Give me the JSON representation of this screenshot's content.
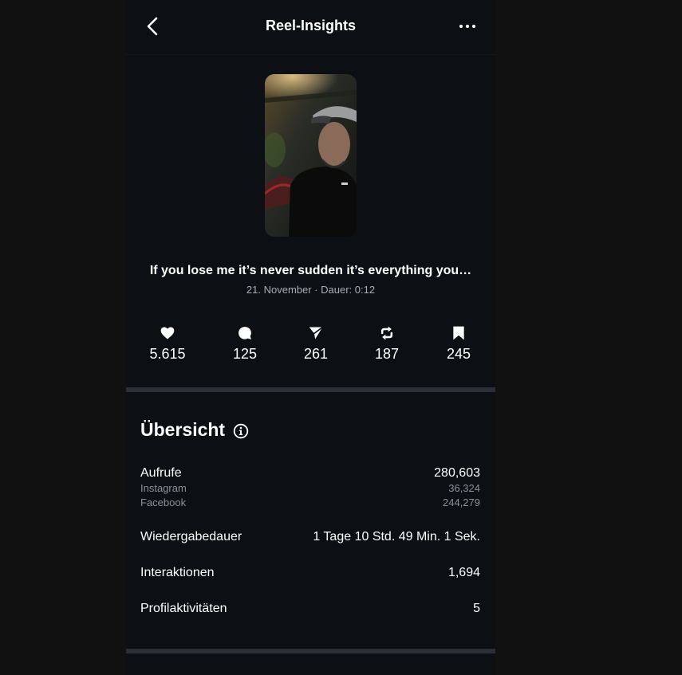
{
  "header": {
    "title": "Reel-Insights",
    "back_icon": "chevron-left-icon",
    "more_icon": "more-horizontal-icon"
  },
  "reel": {
    "caption": "If you lose me it’s never sudden it’s everything you…",
    "meta": "21. November · Dauer: 0:12"
  },
  "stats": [
    {
      "icon": "heart-icon",
      "value": "5.615"
    },
    {
      "icon": "comment-icon",
      "value": "125"
    },
    {
      "icon": "send-icon",
      "value": "261"
    },
    {
      "icon": "repost-icon",
      "value": "187"
    },
    {
      "icon": "bookmark-icon",
      "value": "245"
    }
  ],
  "overview": {
    "title": "Übersicht",
    "info_icon": "info-icon",
    "views": {
      "label": "Aufrufe",
      "value": "280,603",
      "instagram_label": "Instagram",
      "instagram_value": "36,324",
      "facebook_label": "Facebook",
      "facebook_value": "244,279"
    },
    "watch_time": {
      "label": "Wiedergabedauer",
      "value": "1 Tage 10 Std. 49 Min. 1 Sek."
    },
    "interactions": {
      "label": "Interaktionen",
      "value": "1,694"
    },
    "profile_activity": {
      "label": "Profilaktivitäten",
      "value": "5"
    }
  },
  "colors": {
    "page_background": "#111111",
    "panel_background": "#0c0f14",
    "divider": "#2a2f36",
    "secondary_text": "#a8adb6",
    "tertiary_text": "#8b9099"
  }
}
